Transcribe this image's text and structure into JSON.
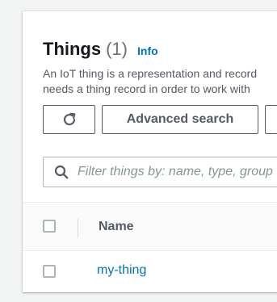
{
  "header": {
    "title": "Things",
    "count": "(1)",
    "info_label": "Info",
    "description_line1": "An IoT thing is a representation and record",
    "description_line2": "needs a thing record in order to work with"
  },
  "actions": {
    "refresh_icon": "refresh-icon",
    "advanced_search_label": "Advanced search"
  },
  "search": {
    "placeholder": "Filter things by: name, type, group",
    "icon": "search-icon"
  },
  "table": {
    "columns": [
      "Name"
    ],
    "rows": [
      {
        "name": "my-thing"
      }
    ]
  },
  "colors": {
    "link": "#0073bb",
    "border": "#545b64",
    "background": "#f2f3f3"
  }
}
